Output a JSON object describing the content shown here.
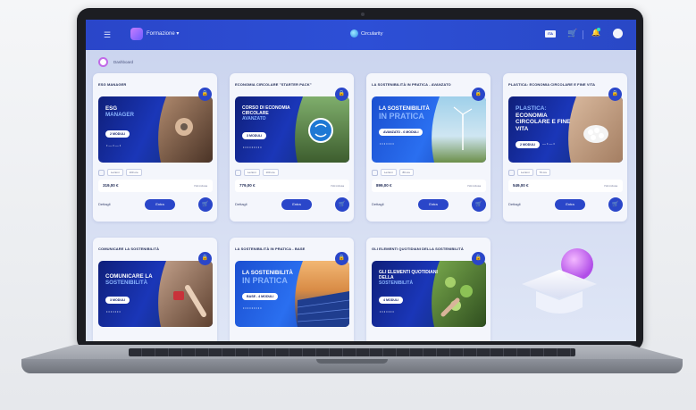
{
  "header": {
    "menu_label": "Formazione",
    "brand_label": "Circularity",
    "flag_label": "ITA"
  },
  "breadcrumb": {
    "label": "Dashboard"
  },
  "cards": [
    {
      "title": "ESG MANAGER",
      "banner_line1": "ESG",
      "banner_line2": "MANAGER",
      "pill": "2 MODULI",
      "tag1": "Lezioni",
      "tag2": "100 ore",
      "price": "319,00 €",
      "vat": "IVA inclusa",
      "details_label": "Dettagli",
      "button_label": "Entra"
    },
    {
      "title": "ECONOMIA CIRCOLARE \"STARTER PACK\"",
      "banner_line1": "CORSO DI ECONOMIA CIRCOLARE",
      "banner_line2": "AVANZATO",
      "pill": "3 MODULI",
      "tag1": "Lezioni",
      "tag2": "100 ore",
      "price": "779,00 €",
      "vat": "IVA inclusa",
      "details_label": "Dettagli",
      "button_label": "Entra"
    },
    {
      "title": "LA SOSTENIBILITÀ IN PRATICA - AVANZATO",
      "banner_line1": "LA SOSTENIBILITÀ",
      "banner_line2": "IN PRATICA",
      "pill": "AVANZATO - 6 MODULI",
      "tag1": "Lezioni",
      "tag2": "80 ore",
      "price": "899,00 €",
      "vat": "IVA inclusa",
      "details_label": "Dettagli",
      "button_label": "Entra"
    },
    {
      "title": "PLASTICA: ECONOMIA CIRCOLARE E FINE VITA",
      "banner_line1": "PLASTICA:",
      "banner_line2": "ECONOMIA CIRCOLARE E FINE VITA",
      "pill": "2 MODULI",
      "tag1": "Lezioni",
      "tag2": "70 ore",
      "price": "549,00 €",
      "vat": "IVA inclusa",
      "details_label": "Dettagli",
      "button_label": "Entra"
    },
    {
      "title": "COMUNICARE LA SOSTENIBILITÀ",
      "banner_line1": "COMUNICARE LA",
      "banner_line2": "SOSTENIBILITÀ",
      "pill": "3 MODULI"
    },
    {
      "title": "LA SOSTENIBILITÀ IN PRATICA - BASE",
      "banner_line1": "LA SOSTENIBILITÀ",
      "banner_line2": "IN PRATICA",
      "pill": "BASE - 4 MODULI"
    },
    {
      "title": "GLI ELEMENTI QUOTIDIANI DELLA SOSTENIBILITÀ",
      "banner_line1": "GLI ELEMENTI QUOTIDIANI DELLA",
      "banner_line2": "SOSTENIBILITÀ",
      "pill": "4 MODULI"
    }
  ],
  "colors": {
    "accent": "#2a46c9",
    "banner_dark": "#0f1f7a",
    "highlight": "#89b4ff"
  },
  "icons": [
    "menu-icon",
    "formazione-icon",
    "brand-icon",
    "cart-icon",
    "bell-icon",
    "avatar",
    "lock-icon",
    "add-to-cart-icon",
    "graduation-cap-icon"
  ]
}
